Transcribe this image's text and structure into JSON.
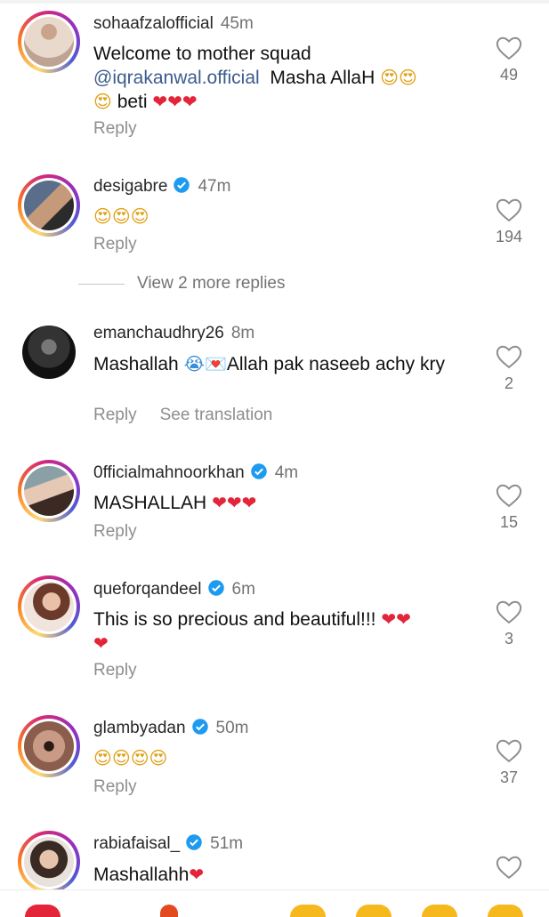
{
  "view_more_label": "View 2 more replies",
  "reply_label": "Reply",
  "see_translation_label": "See translation",
  "comments": [
    {
      "username": "sohaafzalofficial",
      "time": "45m",
      "verified": false,
      "likes": "49",
      "text_parts": [
        "Welcome to mother squad",
        "@iqrakanwal.official",
        "Masha AllaH",
        "beti"
      ]
    },
    {
      "username": "desigabre",
      "time": "47m",
      "verified": true,
      "likes": "194",
      "text_parts": []
    },
    {
      "username": "emanchaudhry26",
      "time": "8m",
      "verified": false,
      "likes": "2",
      "text_parts": [
        "Mashallah",
        "Allah pak naseeb achy kry"
      ]
    },
    {
      "username": "0fficialmahnoorkhan",
      "time": "4m",
      "verified": true,
      "likes": "15",
      "text_parts": [
        "MASHALLAH"
      ]
    },
    {
      "username": "queforqandeel",
      "time": "6m",
      "verified": true,
      "likes": "3",
      "text_parts": [
        "This is so precious and beautiful!!!"
      ]
    },
    {
      "username": "glambyadan",
      "time": "50m",
      "verified": true,
      "likes": "37",
      "text_parts": []
    },
    {
      "username": "rabiafaisal_",
      "time": "51m",
      "verified": true,
      "likes": "",
      "text_parts": [
        "Mashallahh"
      ]
    }
  ],
  "colors": {
    "mention": "#3c5c8c",
    "heart": "#e3253a",
    "verified": "#1d9bf0",
    "muted": "#737373"
  }
}
